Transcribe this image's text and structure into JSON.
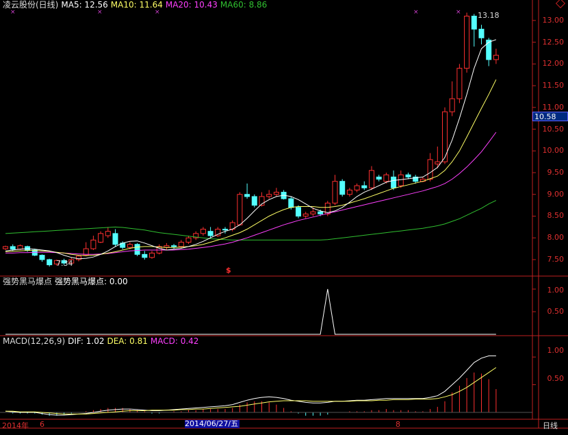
{
  "header": {
    "title": "凌云股份(日线)",
    "ma5": "MA5: 12.56",
    "ma10": "MA10: 11.64",
    "ma20": "MA20: 10.43",
    "ma60": "MA60: 8.86"
  },
  "colors": {
    "bg": "#000000",
    "axis": "#c02020",
    "up": "#ff3030",
    "down": "#54ffff",
    "ma5": "#ffffff",
    "ma10": "#ffff66",
    "ma20": "#ff40ff",
    "ma60": "#30c030",
    "current_price_bg": "#002a80"
  },
  "price_axis": [
    "13.00",
    "12.50",
    "12.00",
    "11.50",
    "11.00",
    "10.50",
    "10.00",
    "9.50",
    "9.00",
    "8.50",
    "8.00",
    "7.50"
  ],
  "current_price": "10.58",
  "high_label": "13.18",
  "low_label": "7.34",
  "signal_marker": "$",
  "indicator1": {
    "title": "强势黑马爆点",
    "value_label": "强势黑马爆点: 0.00",
    "axis": [
      "1.00",
      "0.50"
    ]
  },
  "macd": {
    "title": "MACD(12,26,9)",
    "dif": "DIF: 1.02",
    "dea": "DEA: 0.81",
    "macd": "MACD: 0.42",
    "axis": [
      "1.00",
      "0.50"
    ]
  },
  "bottom": {
    "year": "2014年",
    "month1": "6",
    "date_box": "2014/06/27/五",
    "month2": "8",
    "period": "日线"
  },
  "chart_data": {
    "type": "candlestick",
    "ylim": [
      7.2,
      13.25
    ],
    "candles": [
      [
        7.75,
        7.8,
        7.72,
        7.82
      ],
      [
        7.8,
        7.74,
        7.7,
        7.85
      ],
      [
        7.74,
        7.82,
        7.72,
        7.85
      ],
      [
        7.8,
        7.72,
        7.68,
        7.82
      ],
      [
        7.72,
        7.6,
        7.58,
        7.75
      ],
      [
        7.6,
        7.5,
        7.45,
        7.62
      ],
      [
        7.5,
        7.38,
        7.34,
        7.52
      ],
      [
        7.4,
        7.48,
        7.36,
        7.5
      ],
      [
        7.48,
        7.42,
        7.38,
        7.52
      ],
      [
        7.42,
        7.5,
        7.4,
        7.55
      ],
      [
        7.5,
        7.58,
        7.46,
        7.6
      ],
      [
        7.6,
        7.75,
        7.58,
        7.9
      ],
      [
        7.75,
        7.95,
        7.72,
        8.05
      ],
      [
        7.9,
        8.1,
        7.88,
        8.15
      ],
      [
        8.05,
        8.15,
        8.0,
        8.25
      ],
      [
        8.1,
        7.85,
        7.8,
        8.2
      ],
      [
        7.88,
        7.78,
        7.74,
        7.92
      ],
      [
        7.78,
        7.85,
        7.74,
        7.9
      ],
      [
        7.85,
        7.62,
        7.58,
        7.88
      ],
      [
        7.62,
        7.55,
        7.5,
        7.7
      ],
      [
        7.55,
        7.65,
        7.52,
        7.7
      ],
      [
        7.65,
        7.8,
        7.62,
        7.85
      ],
      [
        7.78,
        7.82,
        7.72,
        7.88
      ],
      [
        7.82,
        7.8,
        7.75,
        7.86
      ],
      [
        7.8,
        7.9,
        7.75,
        7.95
      ],
      [
        7.9,
        8.0,
        7.86,
        8.05
      ],
      [
        8.0,
        8.1,
        7.95,
        8.15
      ],
      [
        8.1,
        8.2,
        8.05,
        8.25
      ],
      [
        8.15,
        8.05,
        8.0,
        8.25
      ],
      [
        8.05,
        8.2,
        8.02,
        8.25
      ],
      [
        8.2,
        8.18,
        8.1,
        8.25
      ],
      [
        8.2,
        8.35,
        8.15,
        8.4
      ],
      [
        8.3,
        9.0,
        8.28,
        9.05
      ],
      [
        9.0,
        8.95,
        8.9,
        9.25
      ],
      [
        8.95,
        8.75,
        8.7,
        9.0
      ],
      [
        8.75,
        8.95,
        8.72,
        9.05
      ],
      [
        8.95,
        9.0,
        8.9,
        9.1
      ],
      [
        9.0,
        9.05,
        8.95,
        9.15
      ],
      [
        9.05,
        8.9,
        8.88,
        9.1
      ],
      [
        8.9,
        8.7,
        8.65,
        8.95
      ],
      [
        8.7,
        8.5,
        8.45,
        8.75
      ],
      [
        8.5,
        8.55,
        8.45,
        8.6
      ],
      [
        8.55,
        8.6,
        8.5,
        8.7
      ],
      [
        8.6,
        8.55,
        8.5,
        8.65
      ],
      [
        8.55,
        8.8,
        8.5,
        8.85
      ],
      [
        8.8,
        9.3,
        8.75,
        9.45
      ],
      [
        9.3,
        9.0,
        8.95,
        9.35
      ],
      [
        9.0,
        9.1,
        8.95,
        9.15
      ],
      [
        9.1,
        9.2,
        9.05,
        9.25
      ],
      [
        9.2,
        9.15,
        9.1,
        9.3
      ],
      [
        9.15,
        9.55,
        9.1,
        9.65
      ],
      [
        9.4,
        9.35,
        9.3,
        9.45
      ],
      [
        9.3,
        9.45,
        9.25,
        9.5
      ],
      [
        9.4,
        9.15,
        9.1,
        9.55
      ],
      [
        9.2,
        9.45,
        9.15,
        9.55
      ],
      [
        9.45,
        9.4,
        9.35,
        9.5
      ],
      [
        9.4,
        9.3,
        9.25,
        9.45
      ],
      [
        9.3,
        9.35,
        9.28,
        9.4
      ],
      [
        9.35,
        9.8,
        9.3,
        9.95
      ],
      [
        9.7,
        9.75,
        9.6,
        10.1
      ],
      [
        9.75,
        10.9,
        9.7,
        11.0
      ],
      [
        10.9,
        11.2,
        10.8,
        11.6
      ],
      [
        11.2,
        11.9,
        11.1,
        12.0
      ],
      [
        11.9,
        13.1,
        11.8,
        13.18
      ],
      [
        13.1,
        12.8,
        12.4,
        13.15
      ],
      [
        12.8,
        12.6,
        12.45,
        12.9
      ],
      [
        12.55,
        12.1,
        11.95,
        12.6
      ],
      [
        12.1,
        12.2,
        12.0,
        12.35
      ]
    ],
    "ma5": [
      7.7,
      7.72,
      7.74,
      7.75,
      7.74,
      7.72,
      7.7,
      7.66,
      7.6,
      7.55,
      7.52,
      7.53,
      7.56,
      7.62,
      7.7,
      7.8,
      7.88,
      7.92,
      7.93,
      7.88,
      7.82,
      7.76,
      7.72,
      7.74,
      7.76,
      7.8,
      7.85,
      7.92,
      8.0,
      8.08,
      8.15,
      8.2,
      8.3,
      8.45,
      8.62,
      8.78,
      8.88,
      8.95,
      8.98,
      8.95,
      8.88,
      8.78,
      8.68,
      8.62,
      8.58,
      8.62,
      8.7,
      8.82,
      8.95,
      9.05,
      9.12,
      9.2,
      9.28,
      9.32,
      9.34,
      9.36,
      9.38,
      9.4,
      9.5,
      9.62,
      9.85,
      10.25,
      10.75,
      11.3,
      11.9,
      12.35,
      12.5,
      12.56
    ],
    "ma10": [
      7.68,
      7.69,
      7.7,
      7.71,
      7.71,
      7.7,
      7.69,
      7.67,
      7.65,
      7.62,
      7.6,
      7.59,
      7.6,
      7.62,
      7.65,
      7.68,
      7.72,
      7.76,
      7.79,
      7.8,
      7.8,
      7.79,
      7.78,
      7.78,
      7.79,
      7.8,
      7.82,
      7.85,
      7.9,
      7.95,
      8.0,
      8.06,
      8.12,
      8.2,
      8.3,
      8.4,
      8.5,
      8.58,
      8.65,
      8.7,
      8.72,
      8.72,
      8.72,
      8.7,
      8.7,
      8.72,
      8.75,
      8.8,
      8.85,
      8.9,
      8.96,
      9.02,
      9.08,
      9.14,
      9.18,
      9.22,
      9.26,
      9.3,
      9.36,
      9.42,
      9.55,
      9.75,
      10.0,
      10.32,
      10.65,
      10.98,
      11.3,
      11.64
    ],
    "ma20": [
      7.65,
      7.65,
      7.66,
      7.66,
      7.67,
      7.67,
      7.67,
      7.66,
      7.65,
      7.64,
      7.63,
      7.62,
      7.62,
      7.63,
      7.64,
      7.66,
      7.68,
      7.7,
      7.71,
      7.72,
      7.72,
      7.72,
      7.72,
      7.72,
      7.73,
      7.74,
      7.76,
      7.78,
      7.8,
      7.83,
      7.86,
      7.9,
      7.95,
      8.0,
      8.06,
      8.12,
      8.18,
      8.24,
      8.3,
      8.35,
      8.4,
      8.44,
      8.48,
      8.52,
      8.56,
      8.6,
      8.64,
      8.68,
      8.72,
      8.76,
      8.8,
      8.84,
      8.88,
      8.92,
      8.96,
      9.0,
      9.04,
      9.08,
      9.13,
      9.18,
      9.25,
      9.35,
      9.48,
      9.63,
      9.8,
      9.98,
      10.2,
      10.43
    ],
    "ma60": [
      8.1,
      8.11,
      8.12,
      8.13,
      8.14,
      8.15,
      8.16,
      8.17,
      8.18,
      8.19,
      8.2,
      8.21,
      8.22,
      8.23,
      8.24,
      8.25,
      8.24,
      8.22,
      8.2,
      8.18,
      8.15,
      8.12,
      8.1,
      8.08,
      8.06,
      8.04,
      8.02,
      8.0,
      7.98,
      7.97,
      7.96,
      7.95,
      7.95,
      7.95,
      7.95,
      7.95,
      7.95,
      7.95,
      7.95,
      7.95,
      7.95,
      7.95,
      7.95,
      7.95,
      7.96,
      7.98,
      8.0,
      8.02,
      8.04,
      8.06,
      8.08,
      8.1,
      8.12,
      8.14,
      8.16,
      8.18,
      8.2,
      8.22,
      8.25,
      8.28,
      8.32,
      8.38,
      8.44,
      8.52,
      8.6,
      8.68,
      8.78,
      8.86
    ],
    "indicator1_values": [
      0,
      0,
      0,
      0,
      0,
      0,
      0,
      0,
      0,
      0,
      0,
      0,
      0,
      0,
      0,
      0,
      0,
      0,
      0,
      0,
      0,
      0,
      0,
      0,
      0,
      0,
      0,
      0,
      0,
      0,
      0,
      0,
      0,
      0,
      0,
      0,
      0,
      0,
      0,
      0,
      0,
      0,
      0,
      0,
      1,
      0,
      0,
      0,
      0,
      0,
      0,
      0,
      0,
      0,
      0,
      0,
      0,
      0,
      0,
      0,
      0,
      0,
      0,
      0,
      0,
      0,
      0,
      0
    ],
    "macd_ylim": [
      -0.05,
      1.2
    ],
    "dif": [
      0.02,
      0.01,
      0.0,
      0.0,
      0.0,
      -0.02,
      -0.04,
      -0.05,
      -0.05,
      -0.04,
      -0.03,
      -0.02,
      0.0,
      0.02,
      0.04,
      0.05,
      0.06,
      0.06,
      0.05,
      0.04,
      0.03,
      0.03,
      0.04,
      0.05,
      0.06,
      0.07,
      0.08,
      0.09,
      0.1,
      0.11,
      0.12,
      0.14,
      0.18,
      0.22,
      0.25,
      0.27,
      0.28,
      0.27,
      0.25,
      0.22,
      0.2,
      0.18,
      0.17,
      0.17,
      0.18,
      0.2,
      0.2,
      0.21,
      0.22,
      0.22,
      0.23,
      0.24,
      0.25,
      0.25,
      0.25,
      0.25,
      0.25,
      0.25,
      0.27,
      0.3,
      0.38,
      0.5,
      0.62,
      0.76,
      0.9,
      0.98,
      1.02,
      1.02
    ],
    "dea": [
      0.02,
      0.02,
      0.01,
      0.01,
      0.01,
      0.0,
      -0.01,
      -0.02,
      -0.03,
      -0.03,
      -0.03,
      -0.03,
      -0.02,
      -0.01,
      0.0,
      0.01,
      0.02,
      0.03,
      0.03,
      0.03,
      0.04,
      0.04,
      0.04,
      0.04,
      0.05,
      0.05,
      0.06,
      0.06,
      0.07,
      0.08,
      0.09,
      0.1,
      0.11,
      0.13,
      0.15,
      0.17,
      0.19,
      0.2,
      0.21,
      0.21,
      0.21,
      0.21,
      0.2,
      0.2,
      0.2,
      0.2,
      0.2,
      0.2,
      0.21,
      0.21,
      0.21,
      0.22,
      0.22,
      0.23,
      0.23,
      0.23,
      0.24,
      0.24,
      0.24,
      0.25,
      0.28,
      0.32,
      0.38,
      0.45,
      0.54,
      0.63,
      0.72,
      0.81
    ]
  }
}
